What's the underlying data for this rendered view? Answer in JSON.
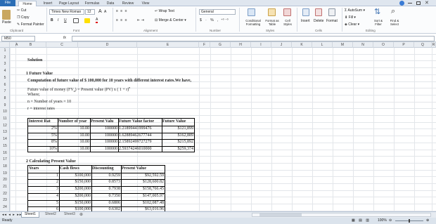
{
  "tabs": {
    "file": "File",
    "home": "Home",
    "insert": "Insert",
    "layout": "Page Layout",
    "formulas": "Formulas",
    "data": "Data",
    "review": "Review",
    "view": "View"
  },
  "ribbon": {
    "cut": "Cut",
    "copy": "Copy",
    "paste": "Paste",
    "format_painter": "Format Painter",
    "font_name": "Times New Roman",
    "font_size": "12",
    "wrap_text": "Wrap Text",
    "merge_center": "Merge & Center",
    "number_format": "General",
    "conditional": "Conditional Formatting",
    "format_table": "Format as Table",
    "cell_styles": "Cell Styles",
    "insert": "Insert",
    "delete": "Delete",
    "format": "Format",
    "autosum": "AutoSum",
    "fill": "Fill",
    "clear": "Clear",
    "sort_filter": "Sort & Filter",
    "find_select": "Find & Select",
    "bold": "B",
    "italic": "I",
    "underline": "U",
    "groups": {
      "clipboard": "Clipboard",
      "font": "Font",
      "alignment": "Alignment",
      "number": "Number",
      "styles": "Styles",
      "cells": "Cells",
      "editing": "Editing"
    }
  },
  "formula_bar": {
    "name_box": "M50",
    "fx": "fx",
    "value": ""
  },
  "columns": [
    "A",
    "B",
    "C",
    "D",
    "E",
    "F",
    "G",
    "H",
    "I",
    "J",
    "K",
    "L",
    "M",
    "N",
    "O",
    "P",
    "Q",
    "R"
  ],
  "rows": [
    "1",
    "2",
    "3",
    "4",
    "5",
    "6",
    "7",
    "8",
    "9",
    "10",
    "11",
    "12",
    "13",
    "14",
    "15",
    "16",
    "17",
    "18",
    "19",
    "20",
    "21",
    "22",
    "23",
    "24"
  ],
  "content": {
    "solution": "Solution",
    "s1_title": "1 Future Value",
    "s1_desc": "Computation of future value of $ 100,000 for 10 years with different interest rates.We have,",
    "s1_formula_a": "Future value of money (FV",
    "s1_formula_sub": "n",
    "s1_formula_b": ") = Present value (PV) x ( 1 + r)",
    "s1_formula_sup": "n",
    "where": "Where;",
    "n_def": "n = Number of years = 10",
    "r_def": "r = interest rates"
  },
  "table1": {
    "headers": [
      "Interest Rat",
      "Number of year",
      "Present Valu",
      "Future Value factor",
      "Future Value"
    ],
    "rows": [
      [
        "2%",
        "10.00",
        "100000",
        "1.21899441999476",
        "$121,899"
      ],
      [
        "5%",
        "10.00",
        "100000",
        "1.62889462677744",
        "$162,889"
      ],
      [
        "8%",
        "10.00",
        "100000",
        "2.15892499727279",
        "$215,892"
      ],
      [
        "10%",
        "10.00",
        "100000",
        "2.59374246010000",
        "$259,374"
      ]
    ]
  },
  "s2_title": "2 Calculating Present Value",
  "table2": {
    "headers": [
      "Years",
      "Cash flows",
      "Discounting",
      "Present Value"
    ],
    "rows": [
      [
        "1",
        "$100,000",
        "0.9259",
        "$92,592.59"
      ],
      [
        "2",
        "$150,000",
        "0.8573",
        "$128,600.82"
      ],
      [
        "3",
        "$200,000",
        "0.7938",
        "$158,766.45"
      ],
      [
        "4",
        "$200,000",
        "0.7350",
        "$147,005.97"
      ],
      [
        "5",
        "$150,000",
        "0.6806",
        "$102,087.48"
      ],
      [
        "6",
        "$100,000",
        "0.6302",
        "$63,016.96"
      ]
    ]
  },
  "sheets": [
    "Sheet1",
    "Sheet2",
    "Sheet3"
  ],
  "status": {
    "ready": "Ready",
    "zoom": "100%"
  }
}
